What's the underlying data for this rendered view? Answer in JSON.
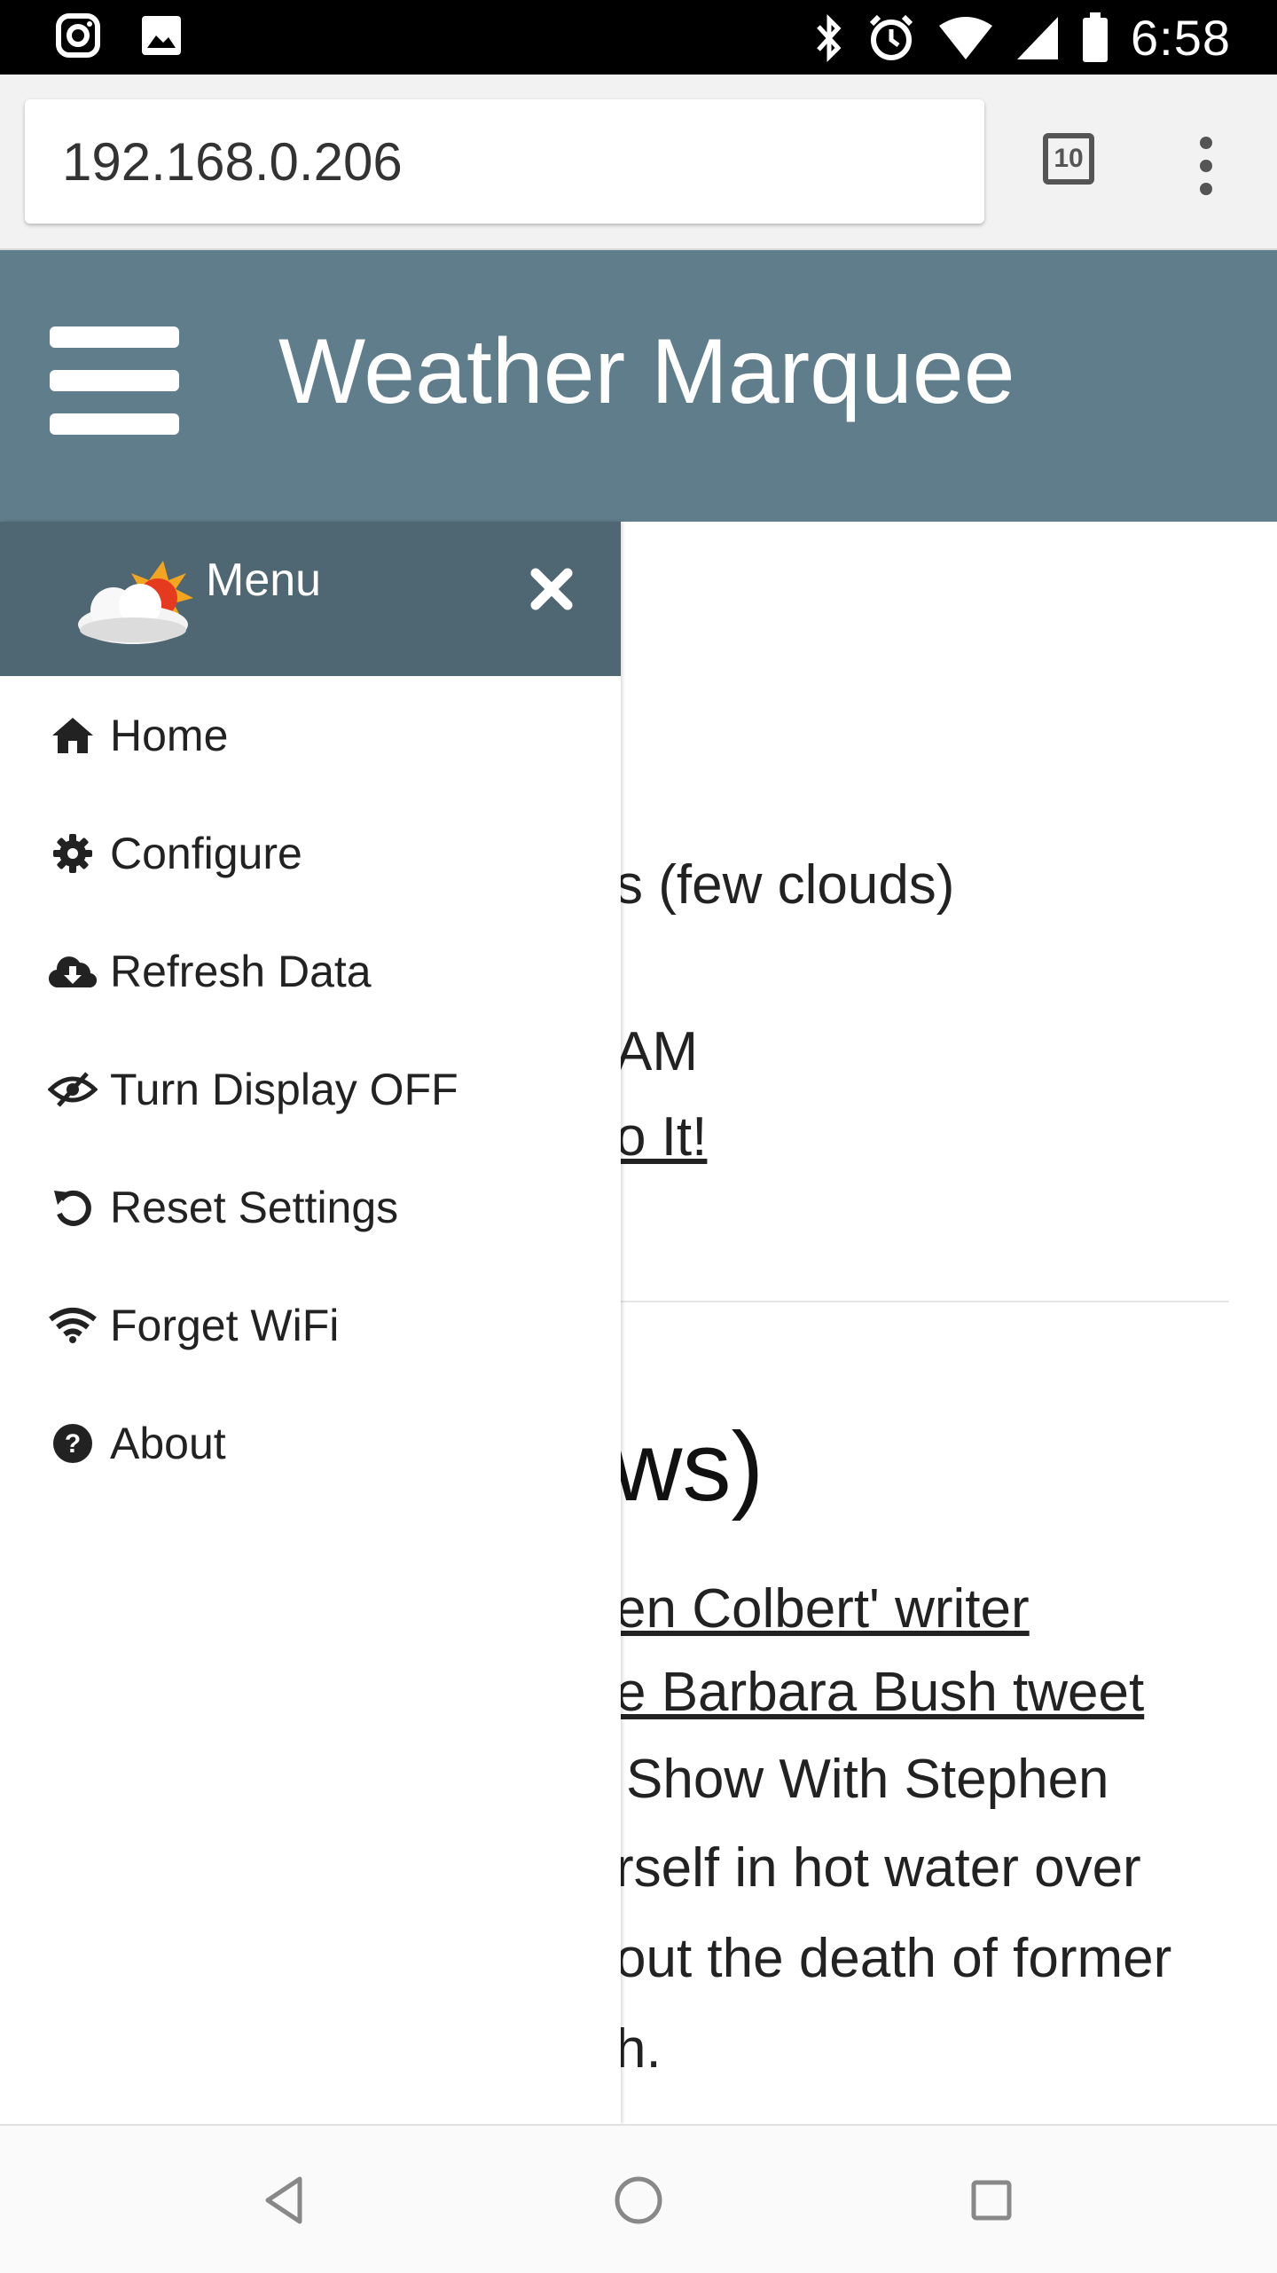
{
  "status_bar": {
    "time": "6:58",
    "left_icons": [
      "instagram-icon",
      "image-icon"
    ],
    "right_icons": [
      "bluetooth-icon",
      "alarm-icon",
      "wifi-icon",
      "signal-icon",
      "battery-icon"
    ]
  },
  "browser": {
    "url": "192.168.0.206",
    "tab_count": "10"
  },
  "app": {
    "title": "Weather Marquee"
  },
  "drawer": {
    "title": "Menu",
    "items": [
      {
        "label": "Home",
        "icon": "home-icon"
      },
      {
        "label": "Configure",
        "icon": "gear-icon"
      },
      {
        "label": "Refresh Data",
        "icon": "cloud-download-icon"
      },
      {
        "label": "Turn Display OFF",
        "icon": "eye-slash-icon"
      },
      {
        "label": "Reset Settings",
        "icon": "undo-icon"
      },
      {
        "label": "Forget WiFi",
        "icon": "wifi-icon"
      },
      {
        "label": "About",
        "icon": "question-circle-icon"
      }
    ]
  },
  "background": {
    "weather_line1": "s (few clouds)",
    "weather_line2": "AM",
    "weather_link": "o It!",
    "news_heading": "ws)",
    "news_link1": "en Colbert' writer",
    "news_link2": "e Barbara Bush tweet",
    "news_text1": "Show With Stephen",
    "news_text2": "rself in hot water over",
    "news_text3": "out the death of former",
    "news_text4": "h."
  },
  "colors": {
    "header": "#607d8b",
    "drawer_header": "#4f6673"
  }
}
